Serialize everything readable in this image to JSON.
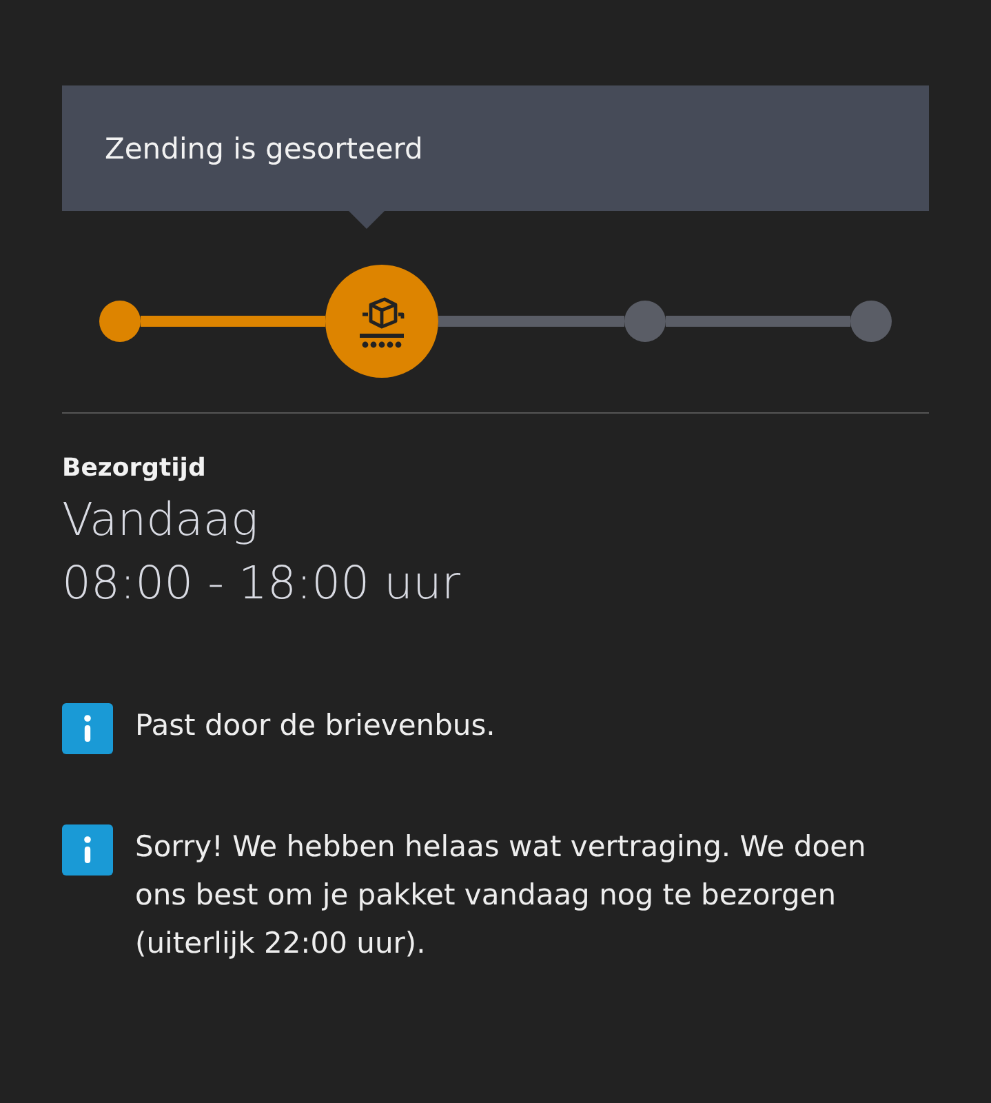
{
  "status": {
    "title": "Zending is gesorteerd"
  },
  "steps": [
    {
      "reached": true,
      "current": false
    },
    {
      "reached": true,
      "current": true
    },
    {
      "reached": false,
      "current": false
    },
    {
      "reached": false,
      "current": false
    }
  ],
  "delivery": {
    "label": "Bezorgtijd",
    "day": "Vandaag",
    "window": "08:00 - 18:00 uur"
  },
  "notices": [
    {
      "text": "Past door de brievenbus."
    },
    {
      "text": "Sorry! We hebben helaas wat vertraging. We doen ons best om je pakket vandaag nog te bezorgen (uiterlijk 22:00 uur)."
    }
  ]
}
